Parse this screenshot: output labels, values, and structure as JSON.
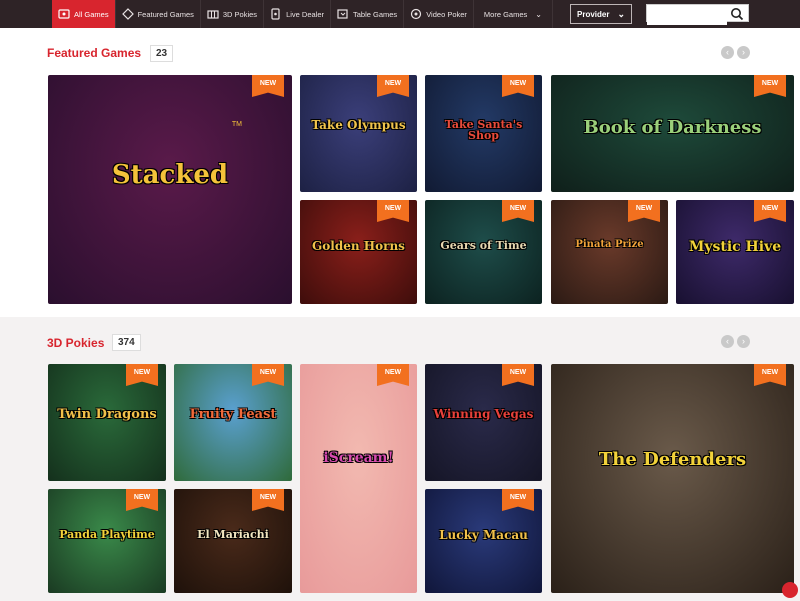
{
  "nav": {
    "items": [
      {
        "label": "All Games",
        "icon": "all-games-icon"
      },
      {
        "label": "Featured Games",
        "icon": "featured-games-icon"
      },
      {
        "label": "3D Pokies",
        "icon": "3d-pokies-icon"
      },
      {
        "label": "Live Dealer",
        "icon": "live-dealer-icon"
      },
      {
        "label": "Table Games",
        "icon": "table-games-icon"
      },
      {
        "label": "Video Poker",
        "icon": "video-poker-icon"
      },
      {
        "label": "More Games",
        "icon": "chevron-down-icon"
      }
    ],
    "provider_label": "Provider",
    "search_placeholder": ""
  },
  "featured": {
    "title": "Featured Games",
    "count": "23",
    "badge": "NEW",
    "games": [
      {
        "name": "Stacked",
        "sub": "TM",
        "colors": [
          "#5a1a4a",
          "#2a0f2e"
        ],
        "text_color": "#f4c23a"
      },
      {
        "name": "Take Olympus",
        "sub": "",
        "colors": [
          "#3b3f7a",
          "#1d2144"
        ],
        "text_color": "#f1c44c"
      },
      {
        "name": "Take Santa's Shop",
        "sub": "",
        "colors": [
          "#233a66",
          "#111a33"
        ],
        "text_color": "#e84a3a"
      },
      {
        "name": "Book of Darkness",
        "sub": "",
        "colors": [
          "#1e4a3a",
          "#0f1f1a"
        ],
        "text_color": "#9ad07a"
      },
      {
        "name": "Golden Horns",
        "sub": "",
        "colors": [
          "#8a1f1a",
          "#3e0d0b"
        ],
        "text_color": "#f2c14a"
      },
      {
        "name": "Gears of Time",
        "sub": "",
        "colors": [
          "#1e4d4a",
          "#0c2220"
        ],
        "text_color": "#e6d7b0"
      },
      {
        "name": "Pinata Prize",
        "sub": "",
        "colors": [
          "#6a3a2a",
          "#2b1a14"
        ],
        "text_color": "#f2a33a"
      },
      {
        "name": "Mystic Hive",
        "sub": "",
        "colors": [
          "#3e2a6a",
          "#181030"
        ],
        "text_color": "#f2d23a"
      }
    ]
  },
  "pokies": {
    "title": "3D Pokies",
    "count": "374",
    "badge": "NEW",
    "games": [
      {
        "name": "Twin Dragons",
        "sub": "",
        "colors": [
          "#2a6a3a",
          "#14301c"
        ],
        "text_color": "#f2c14a"
      },
      {
        "name": "Fruity Feast",
        "sub": "",
        "colors": [
          "#5aa0d0",
          "#2f6a3a"
        ],
        "text_color": "#f26a3a"
      },
      {
        "name": "iScream!",
        "sub": "",
        "colors": [
          "#f2b9b0",
          "#e89a9a"
        ],
        "text_color": "#d84ab0"
      },
      {
        "name": "Winning Vegas",
        "sub": "",
        "colors": [
          "#2a2a4a",
          "#151526"
        ],
        "text_color": "#e8403a"
      },
      {
        "name": "The Defenders",
        "sub": "",
        "colors": [
          "#6a5a4a",
          "#2a2018"
        ],
        "text_color": "#f2d23a"
      },
      {
        "name": "Panda Playtime",
        "sub": "",
        "colors": [
          "#3a8a4a",
          "#1a3a22"
        ],
        "text_color": "#f2d23a"
      },
      {
        "name": "El Mariachi",
        "sub": "",
        "colors": [
          "#4a2a1a",
          "#1e110a"
        ],
        "text_color": "#f2e6c0"
      },
      {
        "name": "Lucky Macau",
        "sub": "",
        "colors": [
          "#2a3a7a",
          "#10163a"
        ],
        "text_color": "#f2c14a"
      }
    ]
  }
}
